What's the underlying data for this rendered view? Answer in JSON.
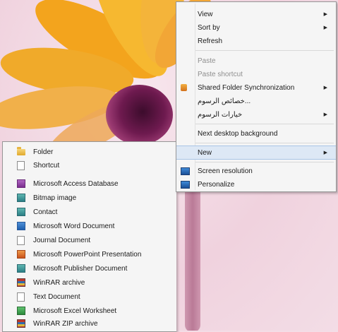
{
  "context_menu": {
    "items": [
      {
        "label": "View",
        "submenu": true,
        "disabled": false
      },
      {
        "label": "Sort by",
        "submenu": true,
        "disabled": false
      },
      {
        "label": "Refresh",
        "submenu": false,
        "disabled": false
      },
      {
        "label": "Paste",
        "submenu": false,
        "disabled": true
      },
      {
        "label": "Paste shortcut",
        "submenu": false,
        "disabled": true
      },
      {
        "label": "Shared Folder Synchronization",
        "submenu": true,
        "disabled": false,
        "icon": "sync-folder-icon"
      },
      {
        "label": "...خصائص الرسوم",
        "submenu": false,
        "disabled": false
      },
      {
        "label": "خيارات الرسوم",
        "submenu": true,
        "disabled": false
      },
      {
        "label": "Next desktop background",
        "submenu": false,
        "disabled": false
      },
      {
        "label": "New",
        "submenu": true,
        "disabled": false,
        "highlighted": true
      },
      {
        "label": "Screen resolution",
        "submenu": false,
        "disabled": false,
        "icon": "screen-resolution-icon"
      },
      {
        "label": "Personalize",
        "submenu": false,
        "disabled": false,
        "icon": "personalize-icon"
      }
    ]
  },
  "new_submenu": {
    "items": [
      {
        "label": "Folder",
        "icon": "folder-icon"
      },
      {
        "label": "Shortcut",
        "icon": "shortcut-icon"
      },
      {
        "label": "Microsoft Access Database",
        "icon": "access-database-icon"
      },
      {
        "label": "Bitmap image",
        "icon": "bitmap-image-icon"
      },
      {
        "label": "Contact",
        "icon": "contact-icon"
      },
      {
        "label": "Microsoft Word Document",
        "icon": "word-document-icon"
      },
      {
        "label": "Journal Document",
        "icon": "journal-document-icon"
      },
      {
        "label": "Microsoft PowerPoint Presentation",
        "icon": "powerpoint-presentation-icon"
      },
      {
        "label": "Microsoft Publisher Document",
        "icon": "publisher-document-icon"
      },
      {
        "label": "WinRAR archive",
        "icon": "winrar-archive-icon"
      },
      {
        "label": "Text Document",
        "icon": "text-document-icon"
      },
      {
        "label": "Microsoft Excel Worksheet",
        "icon": "excel-worksheet-icon"
      },
      {
        "label": "WinRAR ZIP archive",
        "icon": "winrar-zip-icon"
      }
    ]
  },
  "colors": {
    "menu_background": "#f5f5f5",
    "menu_border": "#979797",
    "highlight": "#dde8f5",
    "disabled_text": "#8f8f8f"
  }
}
